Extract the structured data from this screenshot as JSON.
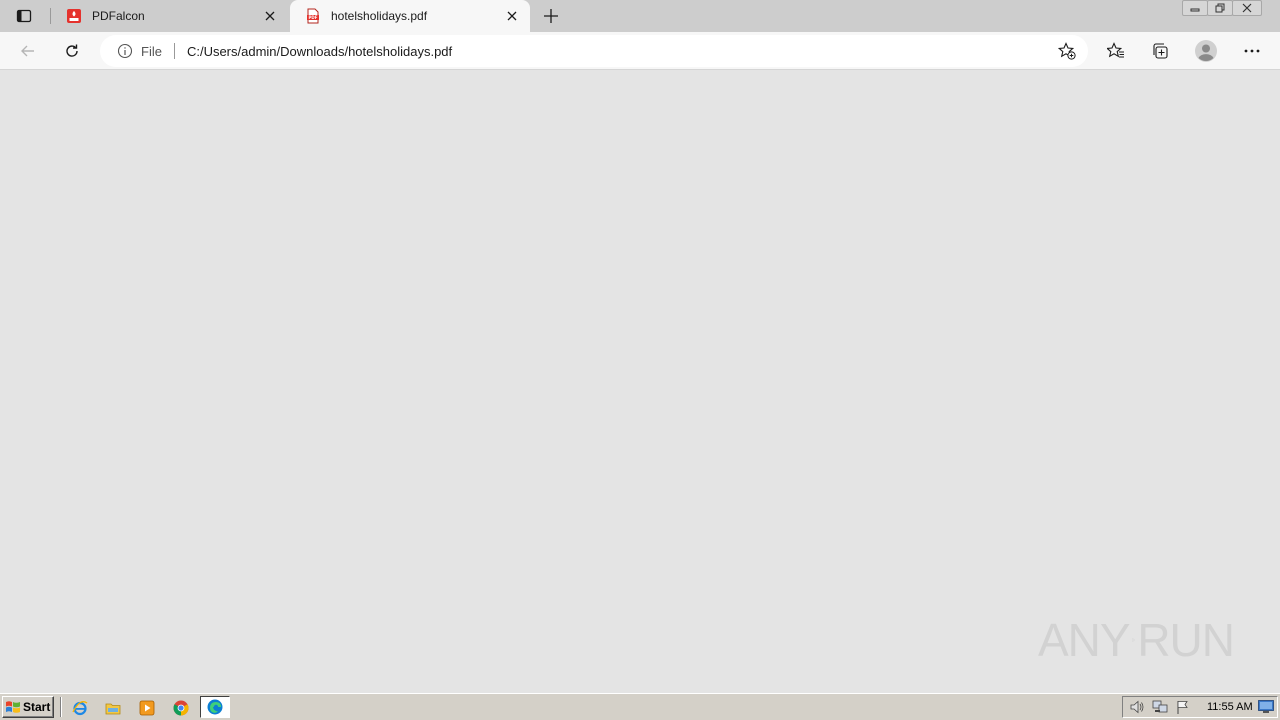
{
  "browser": {
    "tabs": [
      {
        "title": "PDFalcon",
        "favicon": "pdfalcon-icon",
        "active": false
      },
      {
        "title": "hotelsholidays.pdf",
        "favicon": "pdf-file-icon",
        "active": true
      }
    ],
    "address": {
      "scheme_label": "File",
      "url": "C:/Users/admin/Downloads/hotelsholidays.pdf"
    },
    "colors": {
      "tabstrip": "#cdcdcd",
      "toolbar": "#f7f7f7",
      "content_bg": "#e4e4e4",
      "pdf_red": "#e5322d"
    }
  },
  "watermark": {
    "left": "ANY",
    "right": "RUN"
  },
  "taskbar": {
    "start_label": "Start",
    "quick_launch": [
      "internet-explorer-icon",
      "file-explorer-icon",
      "media-player-icon",
      "chrome-icon",
      "edge-icon"
    ],
    "tray_icons": [
      "volume-icon",
      "network-icon",
      "flag-icon"
    ],
    "clock": "11:55 AM"
  }
}
